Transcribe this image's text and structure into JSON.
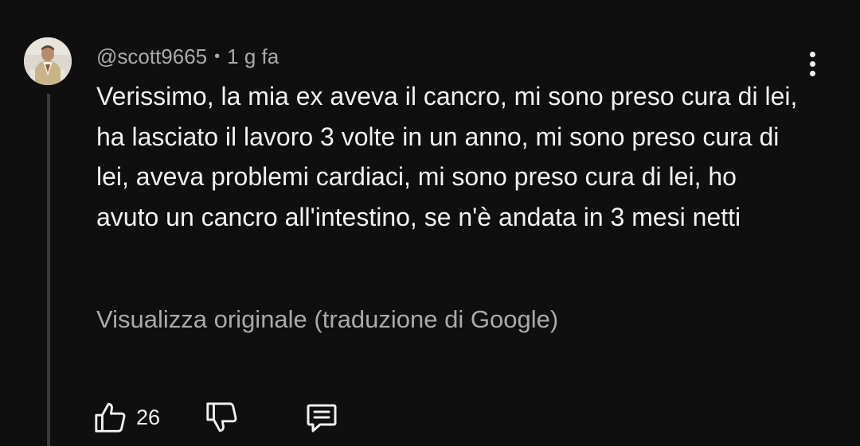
{
  "comment": {
    "author": "@scott9665",
    "separator": "•",
    "time": "1 g fa",
    "text": "Verissimo, la mia ex aveva il cancro, mi sono preso cura di lei, ha lasciato il lavoro 3 volte in un anno, mi sono preso cura di lei, aveva problemi cardiaci, mi sono preso cura di lei, ho avuto un cancro all'intestino, se n'è andata in 3 mesi netti",
    "translation_link": "Visualizza originale (traduzione di Google)",
    "like_count": "26"
  },
  "icons": {
    "avatar": "avatar-photo",
    "menu": "more-vertical-icon",
    "like": "thumbs-up-icon",
    "dislike": "thumbs-down-icon",
    "reply": "reply-comment-icon"
  },
  "colors": {
    "background": "#0f0f0f",
    "primary_text": "#f1f1f1",
    "secondary_text": "#aaaaaa",
    "thread_line": "#3a3a3a"
  }
}
